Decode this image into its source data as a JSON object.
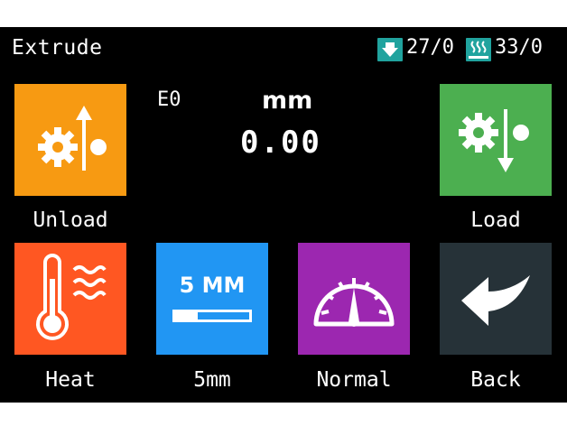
{
  "header": {
    "title": "Extrude",
    "nozzle_temp": "27/0",
    "bed_temp": "33/0"
  },
  "readout": {
    "extruder": "E0",
    "unit": "mm",
    "value": "0.00"
  },
  "buttons": {
    "unload": {
      "label": "Unload",
      "icon": "gear-arrow-up-icon",
      "color": "#f79a12"
    },
    "load": {
      "label": "Load",
      "icon": "gear-arrow-down-icon",
      "color": "#4caf50"
    },
    "heat": {
      "label": "Heat",
      "icon": "thermometer-icon",
      "color": "#ff5722"
    },
    "step": {
      "label": "5mm",
      "icon_text": "5 MM",
      "icon": "step-size-icon",
      "color": "#2196f3",
      "progress": 0.3
    },
    "speed": {
      "label": "Normal",
      "icon": "speedometer-icon",
      "color": "#9c27b0"
    },
    "back": {
      "label": "Back",
      "icon": "back-arrow-icon",
      "color": "#263238"
    }
  },
  "colors": {
    "status_icon": "#20a39e"
  }
}
